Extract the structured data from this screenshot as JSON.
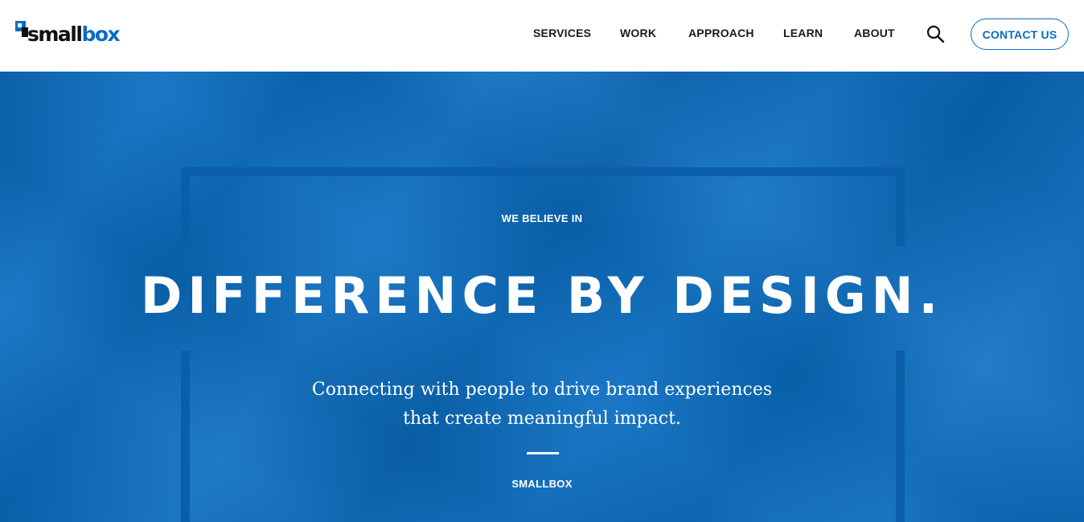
{
  "header": {
    "logo": {
      "text_main": "small",
      "text_accent": "box",
      "accent_color": "#0a6dc0"
    },
    "nav": [
      {
        "label": "SERVICES"
      },
      {
        "label": "WORK"
      },
      {
        "label": "APPROACH"
      },
      {
        "label": "LEARN"
      },
      {
        "label": "ABOUT"
      }
    ],
    "search_icon": "search-icon",
    "contact_label": "CONTACT US"
  },
  "hero": {
    "eyebrow": "WE BELIEVE IN",
    "headline": "DIFFERENCE BY DESIGN.",
    "tagline": "Connecting with people to drive brand experiences that create meaningful impact.",
    "signature": "SMALLBOX",
    "background_color": "#0a6ec2",
    "frame_color": "#0b5fa8"
  }
}
